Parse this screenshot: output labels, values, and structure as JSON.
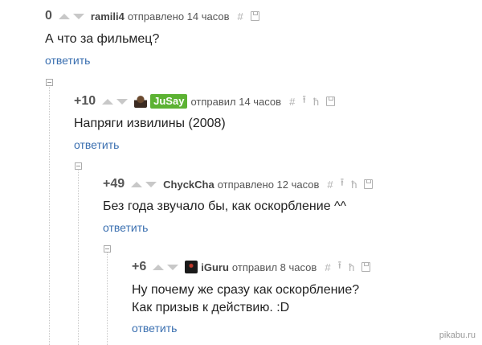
{
  "comments": [
    {
      "rating": "0",
      "author": "ramili4",
      "meta": "отправлено 14 часов",
      "text_lines": [
        "А что за фильмец?"
      ],
      "reply_label": "ответить"
    },
    {
      "rating": "+10",
      "author": "JuSay",
      "meta": "отправил 14 часов",
      "text_lines": [
        "Напряги извилины (2008)"
      ],
      "reply_label": "ответить"
    },
    {
      "rating": "+49",
      "author": "ChyckCha",
      "meta": "отправлено 12 часов",
      "text_lines": [
        "Без года звучало бы, как оскорбление ^^"
      ],
      "reply_label": "ответить"
    },
    {
      "rating": "+6",
      "author": "iGuru",
      "meta": "отправил 8 часов",
      "text_lines": [
        "Ну почему же сразу как оскорбление?",
        "Как призыв к действию. :D"
      ],
      "reply_label": "ответить"
    }
  ],
  "icons": {
    "hash": "#",
    "parent": "⭱",
    "branch": "ħ"
  },
  "watermark": "pikabu.ru",
  "colors": {
    "link": "#3a6fb0",
    "badge": "#5cb233",
    "muted": "#b0b0b0"
  }
}
